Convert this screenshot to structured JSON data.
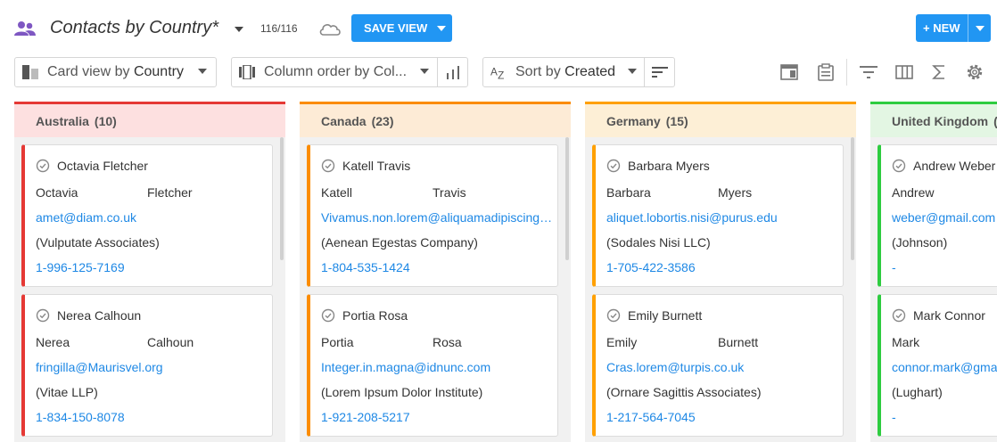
{
  "header": {
    "title": "Contacts by Country*",
    "count": "116/116",
    "save_view_label": "SAVE VIEW",
    "new_label": "+ NEW"
  },
  "toolbar": {
    "card_view_prefix": "Card view by",
    "card_view_value": "Country",
    "column_order_label": "Column order by Col...",
    "sort_prefix": "Sort by",
    "sort_value": "Created"
  },
  "columns": [
    {
      "name": "Australia",
      "count": "(10)",
      "accent": "#e53935",
      "header_bg": "#fde0e0",
      "cards": [
        {
          "name": "Octavia Fletcher",
          "first": "Octavia",
          "last": "Fletcher",
          "email": "amet@diam.co.uk",
          "company": "(Vulputate Associates)",
          "phone": "1-996-125-7169"
        },
        {
          "name": "Nerea Calhoun",
          "first": "Nerea",
          "last": "Calhoun",
          "email": "fringilla@Maurisvel.org",
          "company": "(Vitae LLP)",
          "phone": "1-834-150-8078"
        }
      ]
    },
    {
      "name": "Canada",
      "count": "(23)",
      "accent": "#fb8c00",
      "header_bg": "#fdebd6",
      "cards": [
        {
          "name": "Katell Travis",
          "first": "Katell",
          "last": "Travis",
          "email": "Vivamus.non.lorem@aliquamadipiscing.com",
          "company": "(Aenean Egestas Company)",
          "phone": "1-804-535-1424"
        },
        {
          "name": "Portia Rosa",
          "first": "Portia",
          "last": "Rosa",
          "email": "Integer.in.magna@idnunc.com",
          "company": "(Lorem Ipsum Dolor Institute)",
          "phone": "1-921-208-5217"
        }
      ]
    },
    {
      "name": "Germany",
      "count": "(15)",
      "accent": "#ffa000",
      "header_bg": "#fdefd6",
      "cards": [
        {
          "name": "Barbara Myers",
          "first": "Barbara",
          "last": "Myers",
          "email": "aliquet.lobortis.nisi@purus.edu",
          "company": "(Sodales Nisi LLC)",
          "phone": "1-705-422-3586"
        },
        {
          "name": "Emily Burnett",
          "first": "Emily",
          "last": "Burnett",
          "email": "Cras.lorem@turpis.co.uk",
          "company": "(Ornare Sagittis Associates)",
          "phone": "1-217-564-7045"
        }
      ]
    },
    {
      "name": "United Kingdom",
      "count": "(",
      "accent": "#2ecc40",
      "header_bg": "#e3f6e3",
      "cards": [
        {
          "name": "Andrew Weber",
          "first": "Andrew",
          "last": "",
          "email": "weber@gmail.com",
          "company": "(Johnson)",
          "phone": "-"
        },
        {
          "name": "Mark Connor",
          "first": "Mark",
          "last": "",
          "email": "connor.mark@gmail.com",
          "company": "(Lughart)",
          "phone": "-"
        }
      ]
    }
  ]
}
